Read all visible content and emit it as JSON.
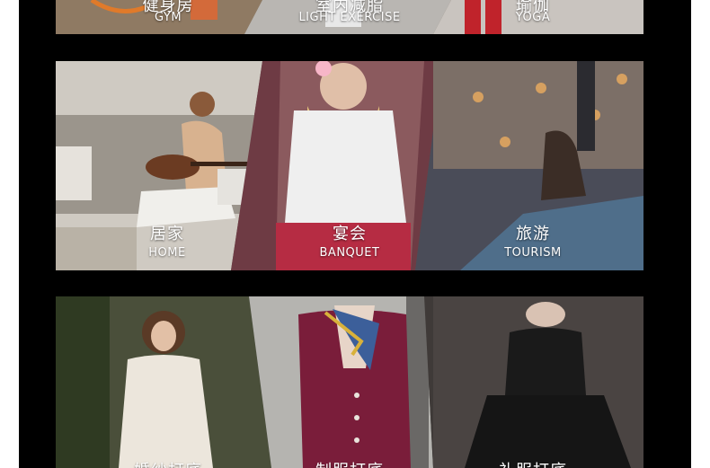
{
  "sections": [
    {
      "name": "sport",
      "items": [
        {
          "zh": "健身房",
          "en": "GYM"
        },
        {
          "zh": "室内减脂",
          "en": "LIGHT EXERCISE"
        },
        {
          "zh": "瑜伽",
          "en": "YOGA"
        }
      ]
    },
    {
      "name": "life",
      "items": [
        {
          "zh": "居家",
          "en": "HOME"
        },
        {
          "zh": "宴会",
          "en": "BANQUET"
        },
        {
          "zh": "旅游",
          "en": "TOURISM"
        }
      ]
    },
    {
      "name": "formal",
      "items": [
        {
          "zh": "婚纱打底",
          "en": ""
        },
        {
          "zh": "制服打底",
          "en": ""
        },
        {
          "zh": "礼服打底",
          "en": ""
        }
      ]
    }
  ],
  "colors": {
    "background": "#000000",
    "page": "#ffffff",
    "text": "#ffffff"
  }
}
